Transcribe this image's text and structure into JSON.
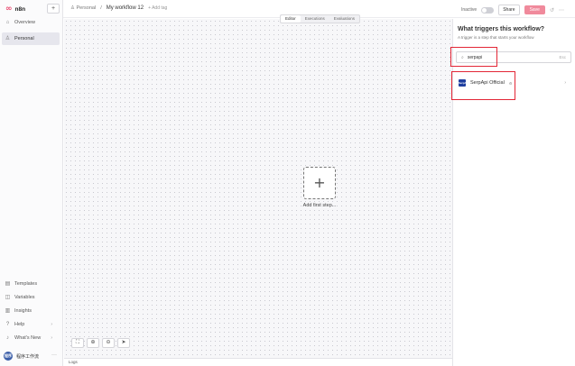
{
  "brand": {
    "name": "n8n",
    "add_button": "+"
  },
  "sidebar": {
    "top_items": [
      {
        "label": "Overview",
        "icon": "home-icon"
      },
      {
        "label": "Personal",
        "icon": "user-icon",
        "active": true
      }
    ],
    "bottom_items": [
      {
        "label": "Templates",
        "icon": "templates-icon"
      },
      {
        "label": "Variables",
        "icon": "variables-icon"
      },
      {
        "label": "Insights",
        "icon": "insights-icon"
      },
      {
        "label": "Help",
        "icon": "help-icon",
        "chevron": "›"
      },
      {
        "label": "What's New",
        "icon": "bell-icon",
        "chevron": "›"
      }
    ],
    "user": {
      "avatar_text": "程序",
      "name": "程序工作流",
      "menu": "···"
    }
  },
  "topbar": {
    "breadcrumb_project": "Personal",
    "breadcrumb_sep": "/",
    "workflow_name": "My workflow 12",
    "add_tag": "+ Add tag",
    "inactive_label": "Inactive",
    "share_label": "Share",
    "save_label": "Save",
    "icons": [
      "history-icon",
      "more-icon"
    ]
  },
  "tabs": [
    {
      "label": "Editor",
      "active": true
    },
    {
      "label": "Executions"
    },
    {
      "label": "Evaluations"
    }
  ],
  "canvas": {
    "first_step_symbol": "+",
    "first_step_label": "Add first step...",
    "zoom_buttons": [
      "fit-view-icon",
      "zoom-in-icon",
      "zoom-out-icon",
      "pointer-icon"
    ],
    "logs_label": "Logs"
  },
  "trigger_panel": {
    "title": "What triggers this workflow?",
    "subtitle": "A trigger is a step that starts your workflow",
    "search_value": "serpapi",
    "clear_label": "Esc",
    "result": {
      "label": "SerpApi Official",
      "icon": "serpapi-icon",
      "icon_text": "SerpApi",
      "badge": "⚙",
      "arrow": "›"
    }
  },
  "colors": {
    "accent": "#ea4b71",
    "highlight": "#e32636",
    "save_bg": "#f08a9c"
  }
}
